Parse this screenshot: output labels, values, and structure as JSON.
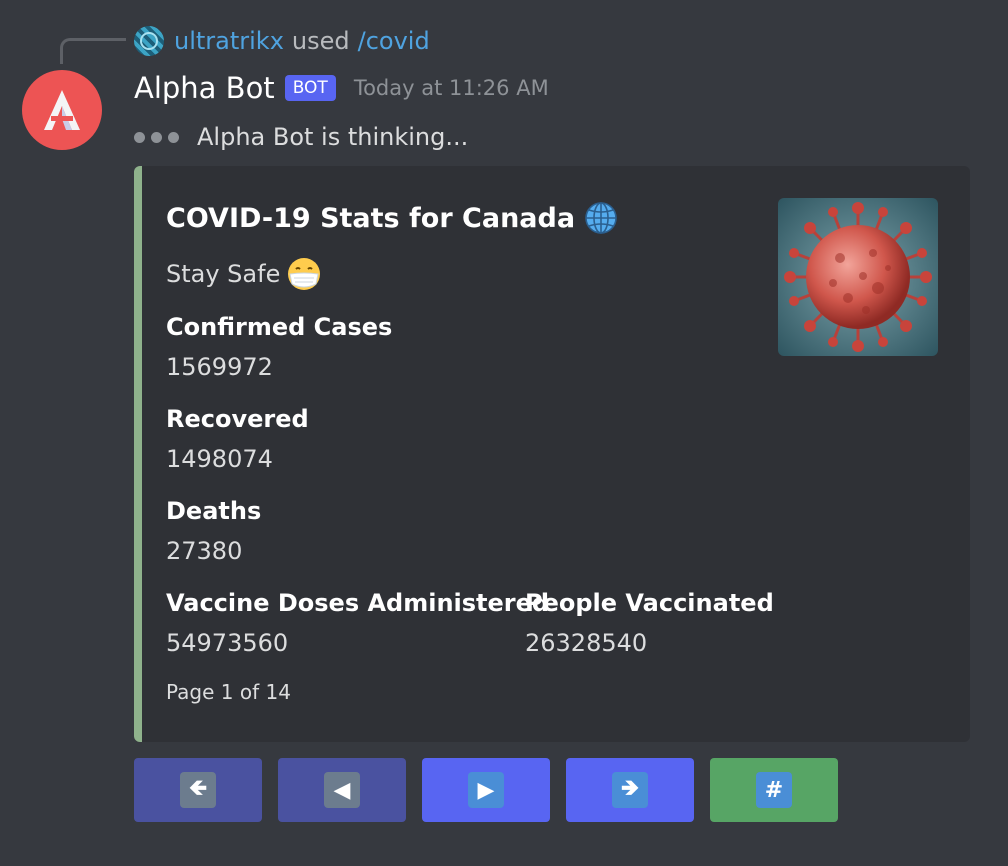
{
  "reply": {
    "username": "ultratrikx",
    "used_text": "used",
    "command": "/covid"
  },
  "message": {
    "author": "Alpha Bot",
    "bot_tag": "BOT",
    "timestamp": "Today at 11:26 AM",
    "thinking_text": "Alpha Bot is thinking..."
  },
  "embed": {
    "accent_color": "#8fb28c",
    "title": "COVID-19 Stats for Canada",
    "description": "Stay Safe",
    "fields": [
      {
        "name": "Confirmed Cases",
        "value": "1569972"
      },
      {
        "name": "Recovered",
        "value": "1498074"
      },
      {
        "name": "Deaths",
        "value": "27380"
      },
      {
        "name": "Vaccine Doses Administered",
        "value": "54973560"
      },
      {
        "name": "People Vaccinated",
        "value": "26328540"
      }
    ],
    "footer": "Page 1 of 14",
    "thumbnail": "coronavirus-image"
  },
  "buttons": [
    {
      "icon": "first-page-arrow-icon",
      "glyph": "🡸",
      "style": "primary-disabled"
    },
    {
      "icon": "previous-triangle-icon",
      "glyph": "◀",
      "style": "primary-disabled"
    },
    {
      "icon": "next-triangle-icon",
      "glyph": "▶",
      "style": "primary"
    },
    {
      "icon": "last-page-arrow-icon",
      "glyph": "🡺",
      "style": "primary"
    },
    {
      "icon": "hash-icon",
      "glyph": "#",
      "style": "success"
    }
  ]
}
